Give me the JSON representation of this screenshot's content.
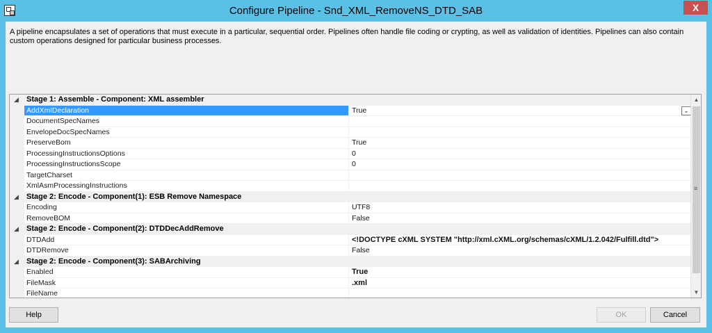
{
  "window": {
    "title": "Configure Pipeline - Snd_XML_RemoveNS_DTD_SAB",
    "close_glyph": "X",
    "icon": "pipeline-app-icon"
  },
  "description": "A pipeline encapsulates a set of operations that must execute in a particular, sequential order. Pipelines often handle file coding or crypting, as well as validation of identities. Pipelines can also contain custom operations designed for particular business processes.",
  "grid": {
    "sections": [
      {
        "title": "Stage 1: Assemble - Component: XML assembler",
        "properties": [
          {
            "name": "AddXmlDeclaration",
            "value": "True"
          },
          {
            "name": "DocumentSpecNames",
            "value": ""
          },
          {
            "name": "EnvelopeDocSpecNames",
            "value": ""
          },
          {
            "name": "PreserveBom",
            "value": "True"
          },
          {
            "name": "ProcessingInstructionsOptions",
            "value": "0"
          },
          {
            "name": "ProcessingInstructionsScope",
            "value": "0"
          },
          {
            "name": "TargetCharset",
            "value": ""
          },
          {
            "name": "XmlAsmProcessingInstructions",
            "value": ""
          }
        ]
      },
      {
        "title": "Stage 2: Encode - Component(1): ESB Remove Namespace",
        "properties": [
          {
            "name": "Encoding",
            "value": "UTF8"
          },
          {
            "name": "RemoveBOM",
            "value": "False"
          }
        ]
      },
      {
        "title": "Stage 2: Encode - Component(2): DTDDecAddRemove",
        "properties": [
          {
            "name": "DTDAdd",
            "value": "<!DOCTYPE cXML SYSTEM \"http://xml.cXML.org/schemas/cXML/1.2.042/Fulfill.dtd\">"
          },
          {
            "name": "DTDRemove",
            "value": "False"
          }
        ]
      },
      {
        "title": "Stage 2: Encode - Component(3): SABArchiving",
        "properties": [
          {
            "name": "Enabled",
            "value": "True"
          },
          {
            "name": "FileMask",
            "value": ".xml"
          },
          {
            "name": "FileName",
            "value": ""
          }
        ]
      }
    ],
    "expander_glyph": "◢",
    "dropdown_glyph": "⌄"
  },
  "scrollbar": {
    "up_glyph": "▲",
    "down_glyph": "▼",
    "grip_glyph": "≡"
  },
  "buttons": {
    "help": "Help",
    "ok": "OK",
    "cancel": "Cancel"
  }
}
